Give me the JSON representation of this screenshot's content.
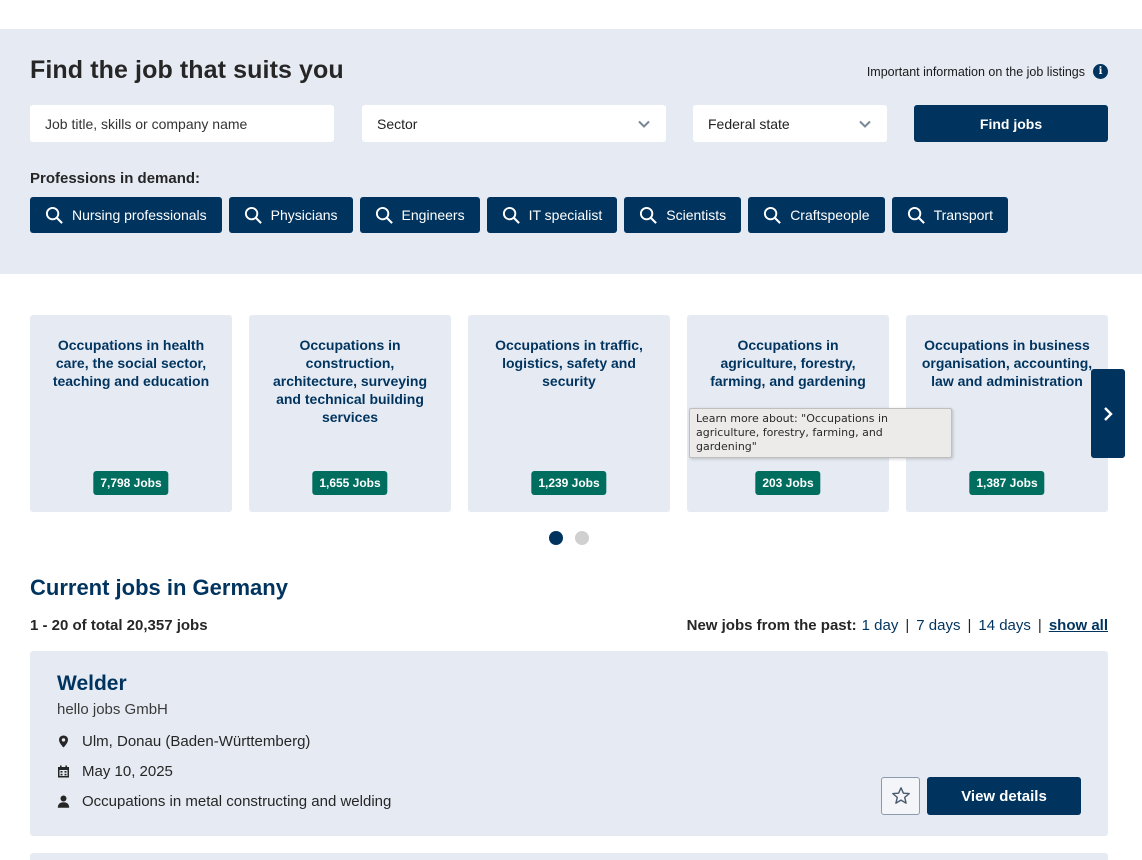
{
  "search": {
    "heading": "Find the job that suits you",
    "info_link": "Important information on the job listings",
    "keyword_placeholder": "Job title, skills or company name",
    "sector_value": "Sector",
    "state_value": "Federal state",
    "submit_label": "Find jobs",
    "demand_label": "Professions in demand:",
    "chips": [
      "Nursing professionals",
      "Physicians",
      "Engineers",
      "IT specialist",
      "Scientists",
      "Craftspeople",
      "Transport"
    ]
  },
  "carousel": {
    "cards": [
      {
        "title": "Occupations in health care, the social sector, teaching and education",
        "jobs": "7,798 Jobs"
      },
      {
        "title": "Occupations in construction, architecture, surveying and technical building services",
        "jobs": "1,655 Jobs"
      },
      {
        "title": "Occupations in traffic, logistics, safety and security",
        "jobs": "1,239 Jobs"
      },
      {
        "title": "Occupations in agriculture, forestry, farming, and gardening",
        "jobs": "203 Jobs"
      },
      {
        "title": "Occupations in business organisation, accounting, law and administration",
        "jobs": "1,387 Jobs"
      }
    ],
    "tooltip": "Learn more about: \"Occupations in agriculture, forestry, farming, and gardening\"",
    "page_count": 2,
    "active_page": 1
  },
  "results": {
    "heading": "Current jobs in Germany",
    "total": "1 - 20 of total 20,357 jobs",
    "filter_label": "New jobs from the past:",
    "filters": [
      "1 day",
      "7 days",
      "14 days",
      "show all"
    ]
  },
  "job": {
    "title": "Welder",
    "company": "hello jobs GmbH",
    "location": "Ulm, Donau (Baden-Württemberg)",
    "date": "May 10, 2025",
    "category": "Occupations in metal constructing and welding",
    "details_label": "View details"
  },
  "icons": [
    "info-icon",
    "chevron-down-icon",
    "search-icon",
    "chevron-right-icon",
    "location-pin-icon",
    "calendar-icon",
    "person-icon",
    "star-icon"
  ],
  "colors": {
    "primary": "#00345f",
    "badge": "#006e5f",
    "panel": "#e6ebf3"
  }
}
